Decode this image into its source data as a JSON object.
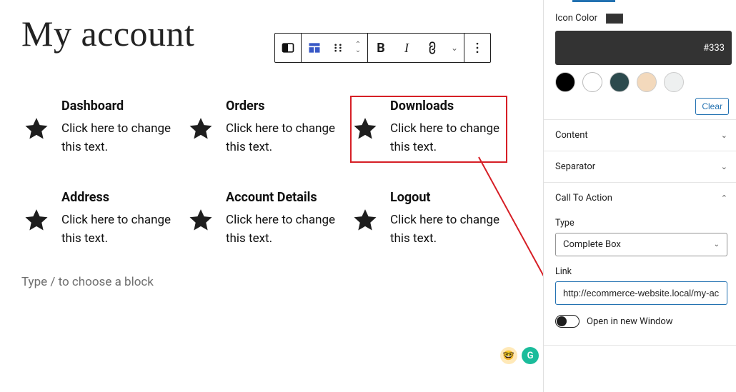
{
  "page": {
    "title": "My account",
    "prompt": "Type / to choose a block"
  },
  "toolbar": {
    "bold": "B",
    "italic": "I"
  },
  "items": [
    {
      "title": "Dashboard",
      "text": "Click here to change this text.",
      "selected": false
    },
    {
      "title": "Orders",
      "text": "Click here to change this text.",
      "selected": false
    },
    {
      "title": "Downloads",
      "text": "Click here to change this text.",
      "selected": true
    },
    {
      "title": "Address",
      "text": "Click here to change this text.",
      "selected": false
    },
    {
      "title": "Account Details",
      "text": "Click here to change this text.",
      "selected": false
    },
    {
      "title": "Logout",
      "text": "Click here to change this text.",
      "selected": false
    }
  ],
  "bubbles": {
    "emoji": "🤓",
    "g": "G"
  },
  "sidebar": {
    "icon_color_label": "Icon Color",
    "hex": "#333",
    "palette": [
      "#000000",
      "#ffffff",
      "#2c4a4d",
      "#f3d9bc",
      "#eef0f0"
    ],
    "clear": "Clear",
    "panels": {
      "content": "Content",
      "separator": "Separator",
      "cta": "Call To Action"
    },
    "cta": {
      "type_label": "Type",
      "type_value": "Complete Box",
      "link_label": "Link",
      "link_value": "http://ecommerce-website.local/my-ac",
      "open_new": "Open in new Window"
    }
  }
}
